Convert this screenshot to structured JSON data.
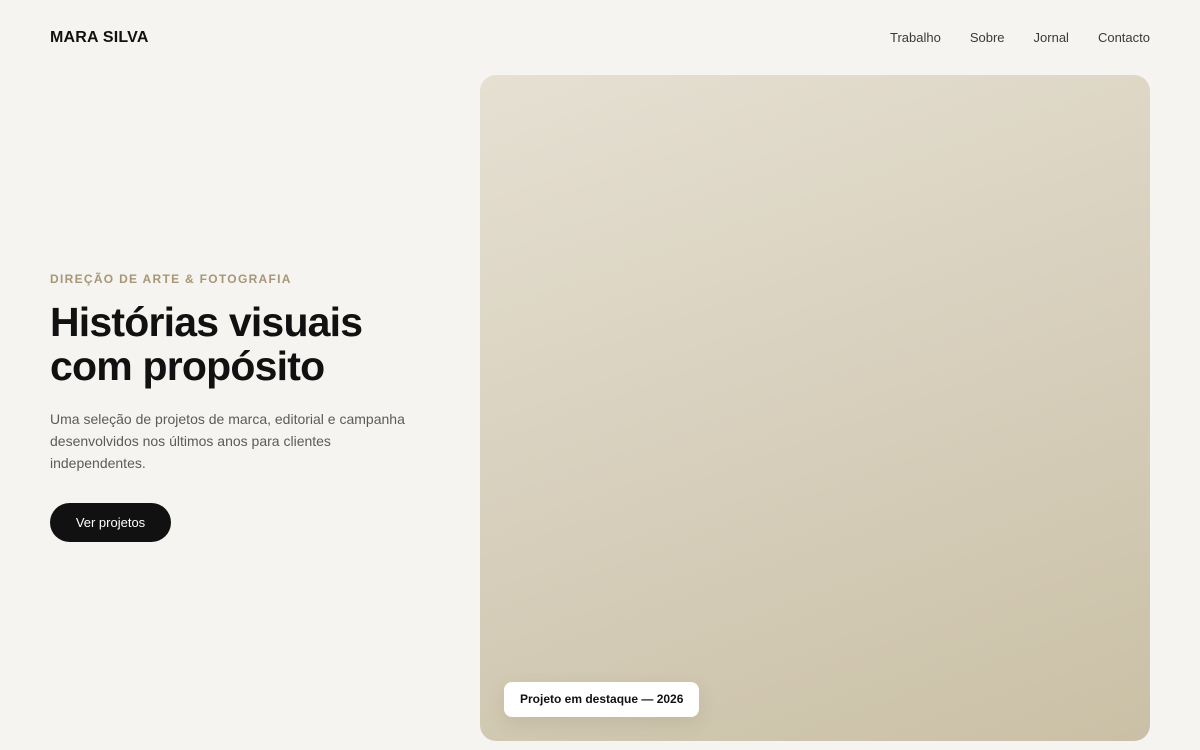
{
  "header": {
    "brand": "MARA SILVA",
    "nav": [
      {
        "label": "Trabalho"
      },
      {
        "label": "Sobre"
      },
      {
        "label": "Jornal"
      },
      {
        "label": "Contacto"
      }
    ]
  },
  "hero": {
    "eyebrow": "DIREÇÃO DE ARTE & FOTOGRAFIA",
    "headline_line1": "Histórias visuais",
    "headline_line2": "com propósito",
    "description": "Uma seleção de projetos de marca, editorial e campanha desenvolvidos nos últimos anos para clientes independentes.",
    "cta_label": "Ver projetos"
  },
  "feature": {
    "badge": "Projeto em destaque — 2026"
  },
  "colors": {
    "background": "#f5f4f0",
    "text": "#111111",
    "accent": "#a89676",
    "button": "#111111"
  }
}
